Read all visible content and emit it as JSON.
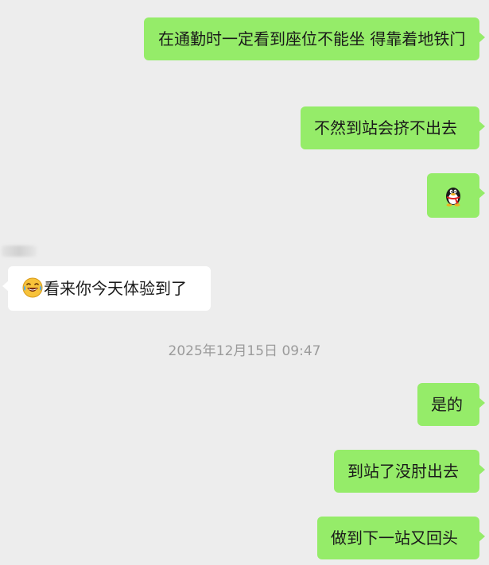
{
  "messages": [
    {
      "side": "out",
      "text": "在通勤时一定看到座位不能坐 得靠着地铁门"
    },
    {
      "side": "out",
      "text": "不然到站会挤不出去"
    },
    {
      "side": "out",
      "sticker": "qq-penguin-icon"
    },
    {
      "side": "in",
      "emoji": "laughing-crying-emoji-icon",
      "text": "看来你今天体验到了"
    },
    {
      "side": "out",
      "text": "是的"
    },
    {
      "side": "out",
      "text": "到站了没肘出去"
    },
    {
      "side": "out",
      "text": "做到下一站又回头"
    }
  ],
  "timestamp": "2025年12月15日 09:47",
  "colors": {
    "background": "#ededed",
    "outgoing_bubble": "#95ec69",
    "incoming_bubble": "#ffffff",
    "timestamp_text": "#9b9b9b"
  }
}
